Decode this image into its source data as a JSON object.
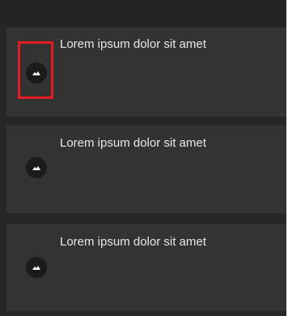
{
  "items": [
    {
      "text": "Lorem ipsum dolor sit amet",
      "icon": "image-icon"
    },
    {
      "text": "Lorem ipsum dolor sit amet",
      "icon": "image-icon"
    },
    {
      "text": "Lorem ipsum dolor sit amet",
      "icon": "image-icon"
    }
  ],
  "highlight": {
    "color": "#e31b23",
    "target": "image-icon"
  }
}
